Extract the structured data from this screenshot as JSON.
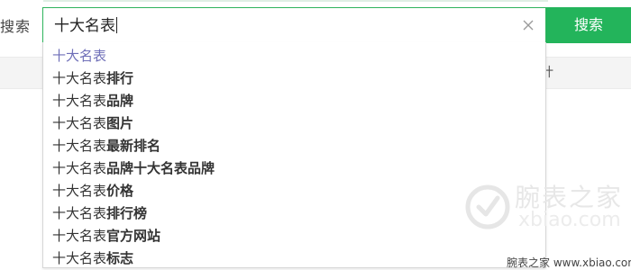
{
  "search": {
    "label": "搜索",
    "query": "十大名表",
    "button_label": "搜索",
    "clear_icon": "close-icon"
  },
  "suggestions": [
    {
      "query": "十大名表",
      "rest": ""
    },
    {
      "query": "十大名表",
      "rest": "排行"
    },
    {
      "query": "十大名表",
      "rest": "品牌"
    },
    {
      "query": "十大名表",
      "rest": "图片"
    },
    {
      "query": "十大名表",
      "rest": "最新排名"
    },
    {
      "query": "十大名表",
      "rest": "品牌十大名表品牌"
    },
    {
      "query": "十大名表",
      "rest": "价格"
    },
    {
      "query": "十大名表",
      "rest": "排行榜"
    },
    {
      "query": "十大名表",
      "rest": "官方网站"
    },
    {
      "query": "十大名表",
      "rest": "标志"
    }
  ],
  "background": {
    "partial_text": "计"
  },
  "watermark": {
    "name": "腕表之家",
    "url": "xbiao.com"
  },
  "footer": {
    "text": "腕表之家 www.xbiao.com"
  },
  "colors": {
    "accent": "#23b45b",
    "first_suggestion": "#6f6fb8"
  }
}
